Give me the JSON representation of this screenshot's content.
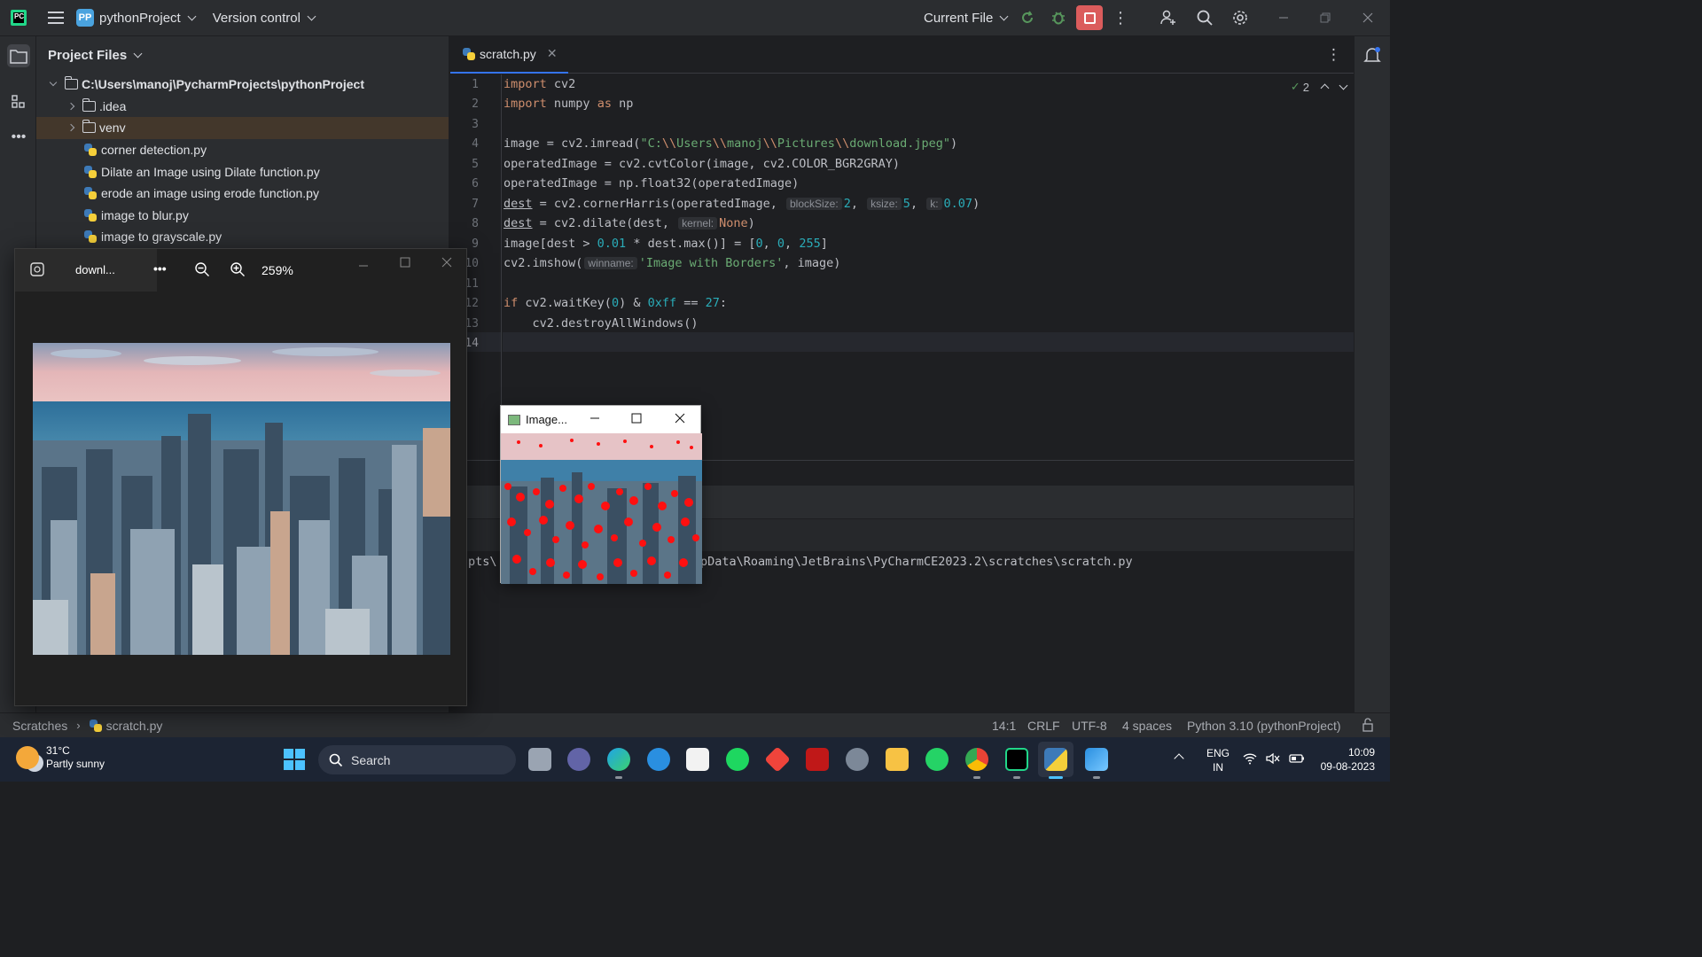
{
  "titlebar": {
    "project_badge": "PP",
    "project_name": "pythonProject",
    "vcs_label": "Version control",
    "run_config": "Current File"
  },
  "project_panel": {
    "header": "Project Files",
    "root": "C:\\Users\\manoj\\PycharmProjects\\pythonProject",
    "items": [
      {
        "label": ".idea",
        "type": "folder"
      },
      {
        "label": "venv",
        "type": "folder"
      },
      {
        "label": "corner detection.py",
        "type": "file"
      },
      {
        "label": "Dilate an Image using Dilate function.py",
        "type": "file"
      },
      {
        "label": "erode an image using erode function.py",
        "type": "file"
      },
      {
        "label": "image to blur.py",
        "type": "file"
      },
      {
        "label": "image to grayscale.py",
        "type": "file"
      }
    ]
  },
  "editor": {
    "tab_label": "scratch.py",
    "inspection_count": "2",
    "line_numbers": [
      "1",
      "2",
      "3",
      "4",
      "5",
      "6",
      "7",
      "8",
      "9",
      "10",
      "11",
      "12",
      "13",
      "14"
    ],
    "code": {
      "l1_kw": "import",
      "l1_rest": " cv2",
      "l2_kw": "import",
      "l2_mid": " numpy ",
      "l2_as": "as",
      "l2_rest": " np",
      "l4_a": "image = cv2.imread(",
      "l4_s1": "\"C:",
      "l4_e1": "\\\\",
      "l4_s2": "Users",
      "l4_e2": "\\\\",
      "l4_s3": "manoj",
      "l4_e3": "\\\\",
      "l4_s4": "Pictures",
      "l4_e4": "\\\\",
      "l4_s5": "download.jpeg\"",
      "l4_b": ")",
      "l5": "operatedImage = cv2.cvtColor(image, cv2.COLOR_BGR2GRAY)",
      "l6": "operatedImage = np.float32(operatedImage)",
      "l7_var": "dest",
      "l7_a": " = cv2.cornerHarris(operatedImage, ",
      "l7_h1": "blockSize:",
      "l7_n1": "2",
      "l7_c1": ", ",
      "l7_h2": "ksize:",
      "l7_n2": "5",
      "l7_c2": ", ",
      "l7_h3": "k:",
      "l7_n3": "0.07",
      "l7_b": ")",
      "l8_var": "dest",
      "l8_a": " = cv2.dilate(dest, ",
      "l8_h1": "kernel:",
      "l8_kw": "None",
      "l8_b": ")",
      "l9_a": "image[dest > ",
      "l9_n1": "0.01",
      "l9_b": " * dest.max()] = [",
      "l9_n2": "0",
      "l9_c1": ", ",
      "l9_n3": "0",
      "l9_c2": ", ",
      "l9_n4": "255",
      "l9_c": "]",
      "l10_a": "cv2.imshow(",
      "l10_h1": "winname:",
      "l10_s": "'Image with Borders'",
      "l10_b": ", image)",
      "l12_kw": "if",
      "l12_a": " cv2.waitKey(",
      "l12_n1": "0",
      "l12_b": ") & ",
      "l12_n2": "0xff",
      "l12_c": " == ",
      "l12_n3": "27",
      "l12_d": ":",
      "l13": "    cv2.destroyAllWindows()"
    },
    "run_output_left": "pts\\",
    "run_output_right": "pData\\Roaming\\JetBrains\\PyCharmCE2023.2\\scratches\\scratch.py"
  },
  "photos_window": {
    "tab_title": "downl...",
    "more_label": "•••",
    "zoom_level": "259%"
  },
  "cv_window": {
    "title": "Image..."
  },
  "statusbar": {
    "breadcrumb_root": "Scratches",
    "breadcrumb_file": "scratch.py",
    "position": "14:1",
    "line_sep": "CRLF",
    "encoding": "UTF-8",
    "indent": "4 spaces",
    "interpreter": "Python 3.10 (pythonProject)"
  },
  "taskbar": {
    "weather_temp": "31°C",
    "weather_desc": "Partly sunny",
    "search_label": "Search",
    "lang_top": "ENG",
    "lang_bottom": "IN",
    "time": "10:09",
    "date": "09-08-2023"
  },
  "colors": {
    "accent": "#3574f0",
    "stop_button": "#db5c5c",
    "selected_row": "#43372b"
  }
}
